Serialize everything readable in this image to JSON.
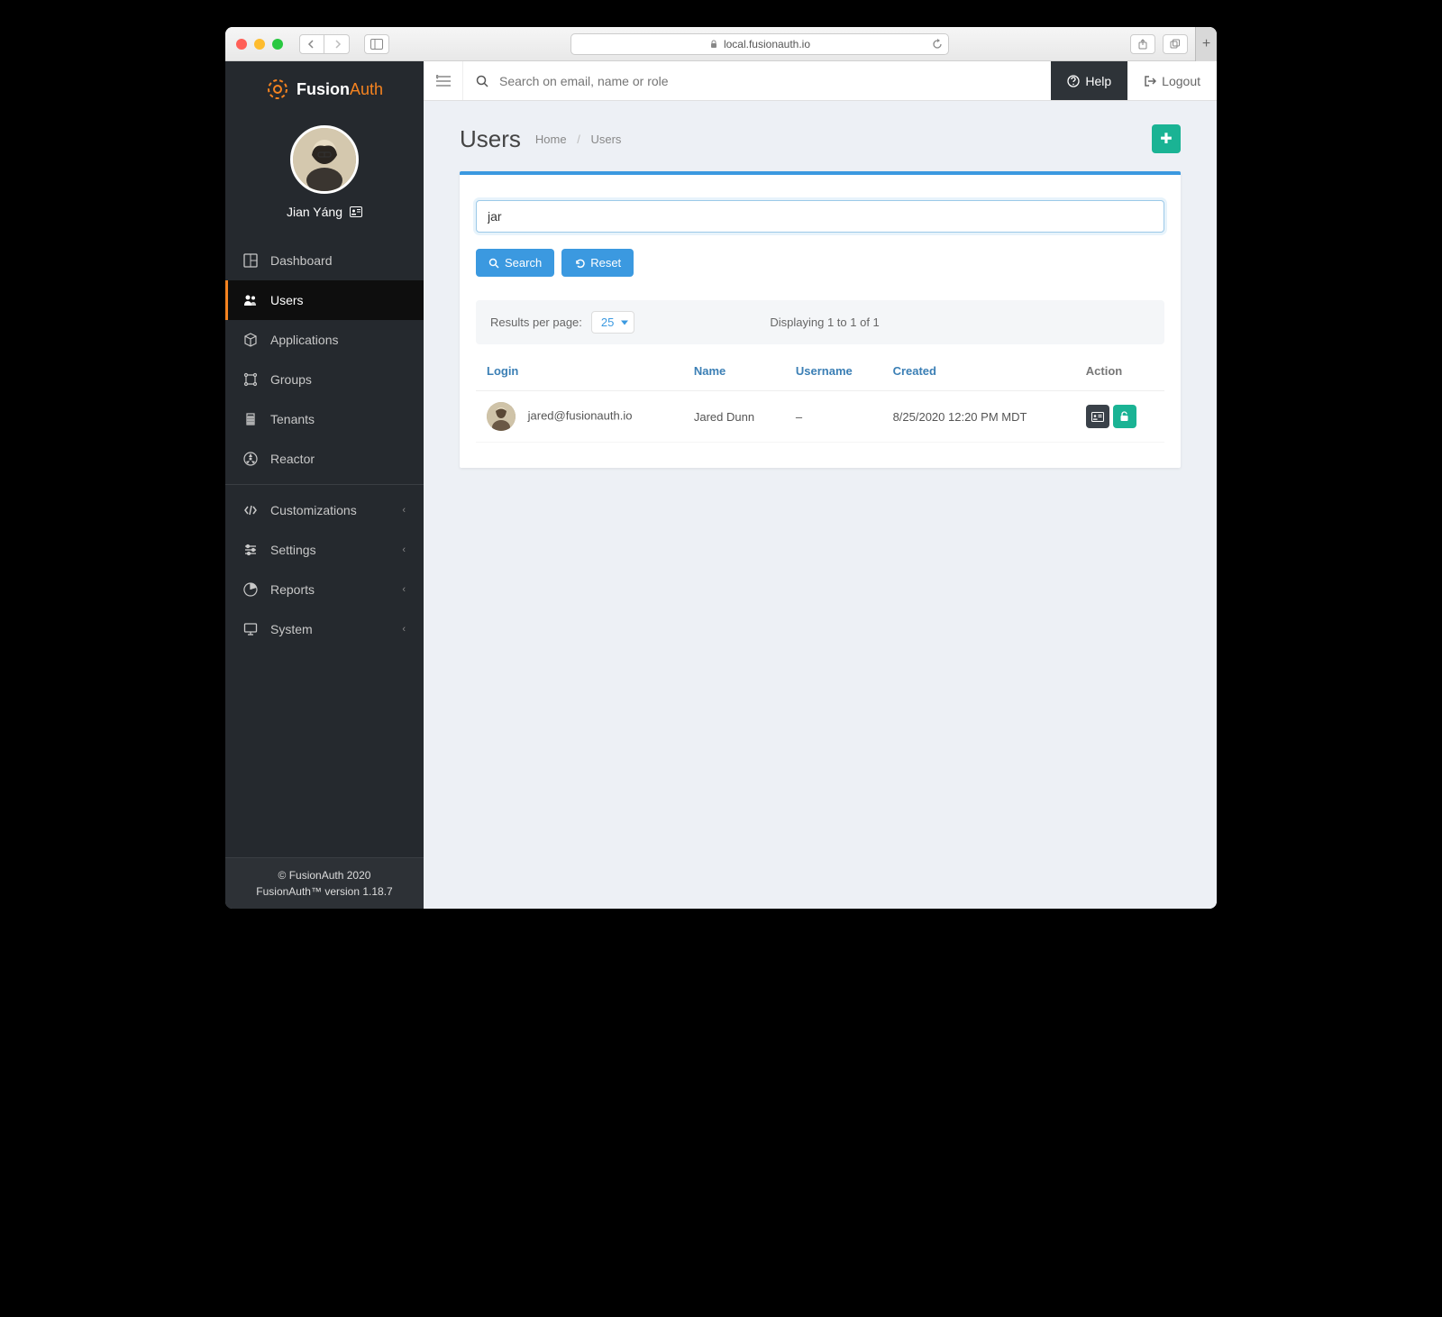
{
  "browser": {
    "url_host": "local.fusionauth.io"
  },
  "brand": {
    "name_a": "Fusion",
    "name_b": "Auth"
  },
  "profile": {
    "display_name": "Jian Yáng"
  },
  "sidebar": {
    "items": [
      {
        "label": "Dashboard",
        "icon": "dashboard"
      },
      {
        "label": "Users",
        "icon": "users",
        "active": true
      },
      {
        "label": "Applications",
        "icon": "cube"
      },
      {
        "label": "Groups",
        "icon": "groups"
      },
      {
        "label": "Tenants",
        "icon": "building"
      },
      {
        "label": "Reactor",
        "icon": "reactor"
      }
    ],
    "groups": [
      {
        "label": "Customizations"
      },
      {
        "label": "Settings"
      },
      {
        "label": "Reports"
      },
      {
        "label": "System"
      }
    ]
  },
  "footer": {
    "line1": "© FusionAuth 2020",
    "line2": "FusionAuth™ version 1.18.7"
  },
  "topbar": {
    "search_placeholder": "Search on email, name or role",
    "help": "Help",
    "logout": "Logout"
  },
  "page": {
    "title": "Users",
    "breadcrumbs": {
      "home": "Home",
      "current": "Users"
    }
  },
  "search": {
    "value": "jar",
    "search_btn": "Search",
    "reset_btn": "Reset"
  },
  "results": {
    "rpp_label": "Results per page:",
    "rpp_value": "25",
    "summary": "Displaying 1 to 1 of 1",
    "columns": {
      "login": "Login",
      "name": "Name",
      "username": "Username",
      "created": "Created",
      "action": "Action"
    },
    "rows": [
      {
        "login": "jared@fusionauth.io",
        "name": "Jared Dunn",
        "username": "–",
        "created": "8/25/2020 12:20 PM MDT"
      }
    ]
  }
}
